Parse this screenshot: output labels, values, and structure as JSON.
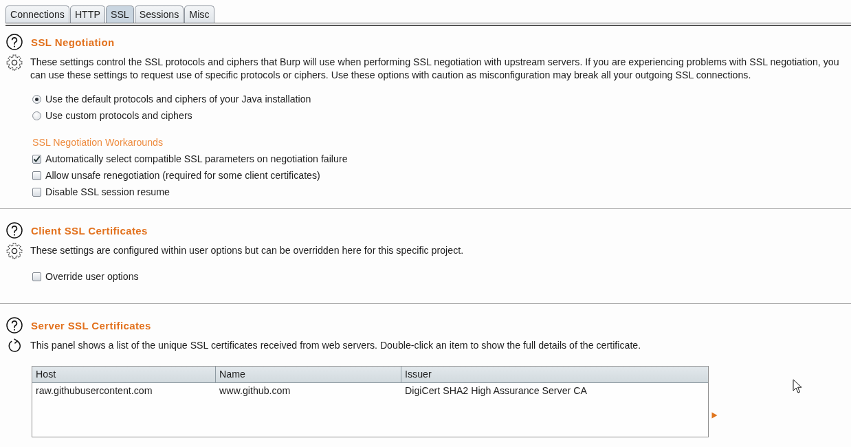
{
  "tabs": [
    {
      "label": "Connections",
      "selected": false
    },
    {
      "label": "HTTP",
      "selected": false
    },
    {
      "label": "SSL",
      "selected": true
    },
    {
      "label": "Sessions",
      "selected": false
    },
    {
      "label": "Misc",
      "selected": false
    }
  ],
  "sections": [
    {
      "kind": "options",
      "title": "SSL Negotiation",
      "description": "These settings control the SSL protocols and ciphers that Burp will use when performing SSL negotiation with upstream servers. If you are experiencing problems with SSL negotiation, you can use these settings to request use of specific protocols or ciphers. Use these options with caution as misconfiguration may break all your outgoing SSL connections.",
      "groups": [
        {
          "options": [
            {
              "kind": "radio",
              "label": "Use the default protocols and ciphers of your Java installation",
              "selected": true
            },
            {
              "kind": "radio",
              "label": "Use custom protocols and ciphers",
              "selected": false
            }
          ]
        },
        {
          "heading": "SSL Negotiation Workarounds",
          "options": [
            {
              "kind": "checkbox",
              "label": "Automatically select compatible SSL parameters on negotiation failure",
              "checked": true
            },
            {
              "kind": "checkbox",
              "label": "Allow unsafe renegotiation (required for some client certificates)",
              "checked": false
            },
            {
              "kind": "checkbox",
              "label": "Disable SSL session resume",
              "checked": false
            }
          ]
        }
      ]
    },
    {
      "kind": "options",
      "title": "Client SSL Certificates",
      "description": "These settings are configured within user options but can be overridden here for this specific project.",
      "groups": [
        {
          "options": [
            {
              "kind": "checkbox",
              "label": "Override user options",
              "checked": false
            }
          ]
        }
      ]
    },
    {
      "kind": "list",
      "title": "Server SSL Certificates",
      "description": "This panel shows a list of the unique SSL certificates received from web servers. Double-click an item to show the full details of the certificate.",
      "table": {
        "columns": [
          "Host",
          "Name",
          "Issuer"
        ],
        "rows": [
          [
            "raw.githubusercontent.com",
            "www.github.com",
            "DigiCert SHA2 High Assurance Server CA"
          ]
        ]
      }
    }
  ]
}
